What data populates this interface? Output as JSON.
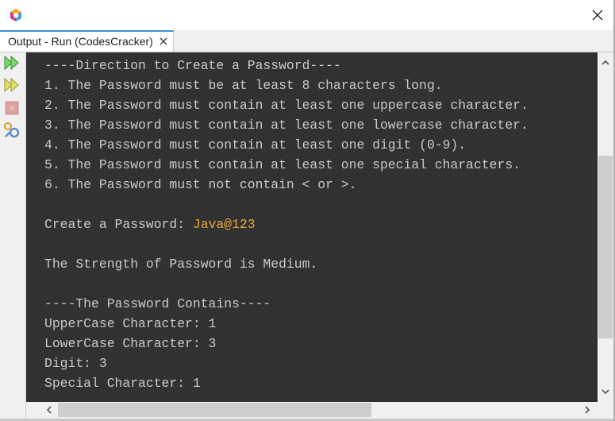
{
  "window": {
    "app_icon": "netbeans-logo-icon",
    "close_icon": "close-icon"
  },
  "tab": {
    "label": "Output - Run (CodesCracker)",
    "close_icon": "close-icon",
    "accent_color": "#3c8fd6"
  },
  "toolbar": {
    "items": [
      {
        "name": "rerun-icon",
        "color": "#3fb53f"
      },
      {
        "name": "rerun-with-options-icon",
        "color": "#c8c83a"
      },
      {
        "name": "stop-icon",
        "color": "#d8a0a0"
      },
      {
        "name": "settings-icon",
        "color": "#5a8fc8"
      }
    ]
  },
  "console": {
    "background": "#2f3133",
    "text_color": "#c8c8c8",
    "input_color": "#e8a532",
    "lines": [
      "----Direction to Create a Password----",
      "1. The Password must be at least 8 characters long.",
      "2. The Password must contain at least one uppercase character.",
      "3. The Password must contain at least one lowercase character.",
      "4. The Password must contain at least one digit (0-9).",
      "5. The Password must contain at least one special characters.",
      "6. The Password must not contain < or >.",
      "",
      "",
      "",
      "The Strength of Password is Medium.",
      "",
      "----The Password Contains----",
      "UpperCase Character: 1",
      "LowerCase Character: 3",
      "Digit: 3",
      "Special Character: 1"
    ],
    "prompt": "Create a Password: ",
    "password_input": "Java@123"
  },
  "scrollbars": {
    "vertical_icons": [
      "chevron-up-icon",
      "chevron-down-icon"
    ],
    "horizontal_icons": [
      "chevron-left-icon",
      "chevron-right-icon"
    ]
  }
}
